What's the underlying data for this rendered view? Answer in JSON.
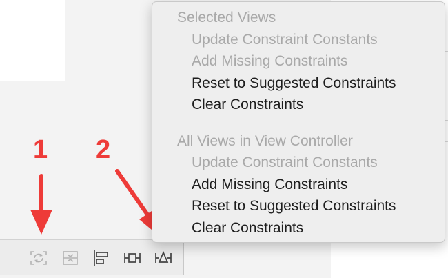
{
  "annotations": {
    "one": "1",
    "two": "2",
    "color": "#ee3b38"
  },
  "toolbar": {
    "icons": [
      "update-frames-icon",
      "embed-in-stack-icon",
      "align-icon",
      "pin-icon",
      "resolve-auto-layout-issues-icon"
    ]
  },
  "menu": {
    "selected_views": {
      "header": "Selected Views",
      "items": [
        {
          "label": "Update Constraint Constants",
          "enabled": false
        },
        {
          "label": "Add Missing Constraints",
          "enabled": false
        },
        {
          "label": "Reset to Suggested Constraints",
          "enabled": true
        },
        {
          "label": "Clear Constraints",
          "enabled": true
        }
      ]
    },
    "all_views": {
      "header": "All Views in View Controller",
      "items": [
        {
          "label": "Update Constraint Constants",
          "enabled": false
        },
        {
          "label": "Add Missing Constraints",
          "enabled": true
        },
        {
          "label": "Reset to Suggested Constraints",
          "enabled": true
        },
        {
          "label": "Clear Constraints",
          "enabled": true
        }
      ]
    }
  },
  "colors": {
    "disabled_text": "#a9a9a9",
    "enabled_text": "#1e1e1e",
    "menu_bg": "#eeeeee"
  }
}
